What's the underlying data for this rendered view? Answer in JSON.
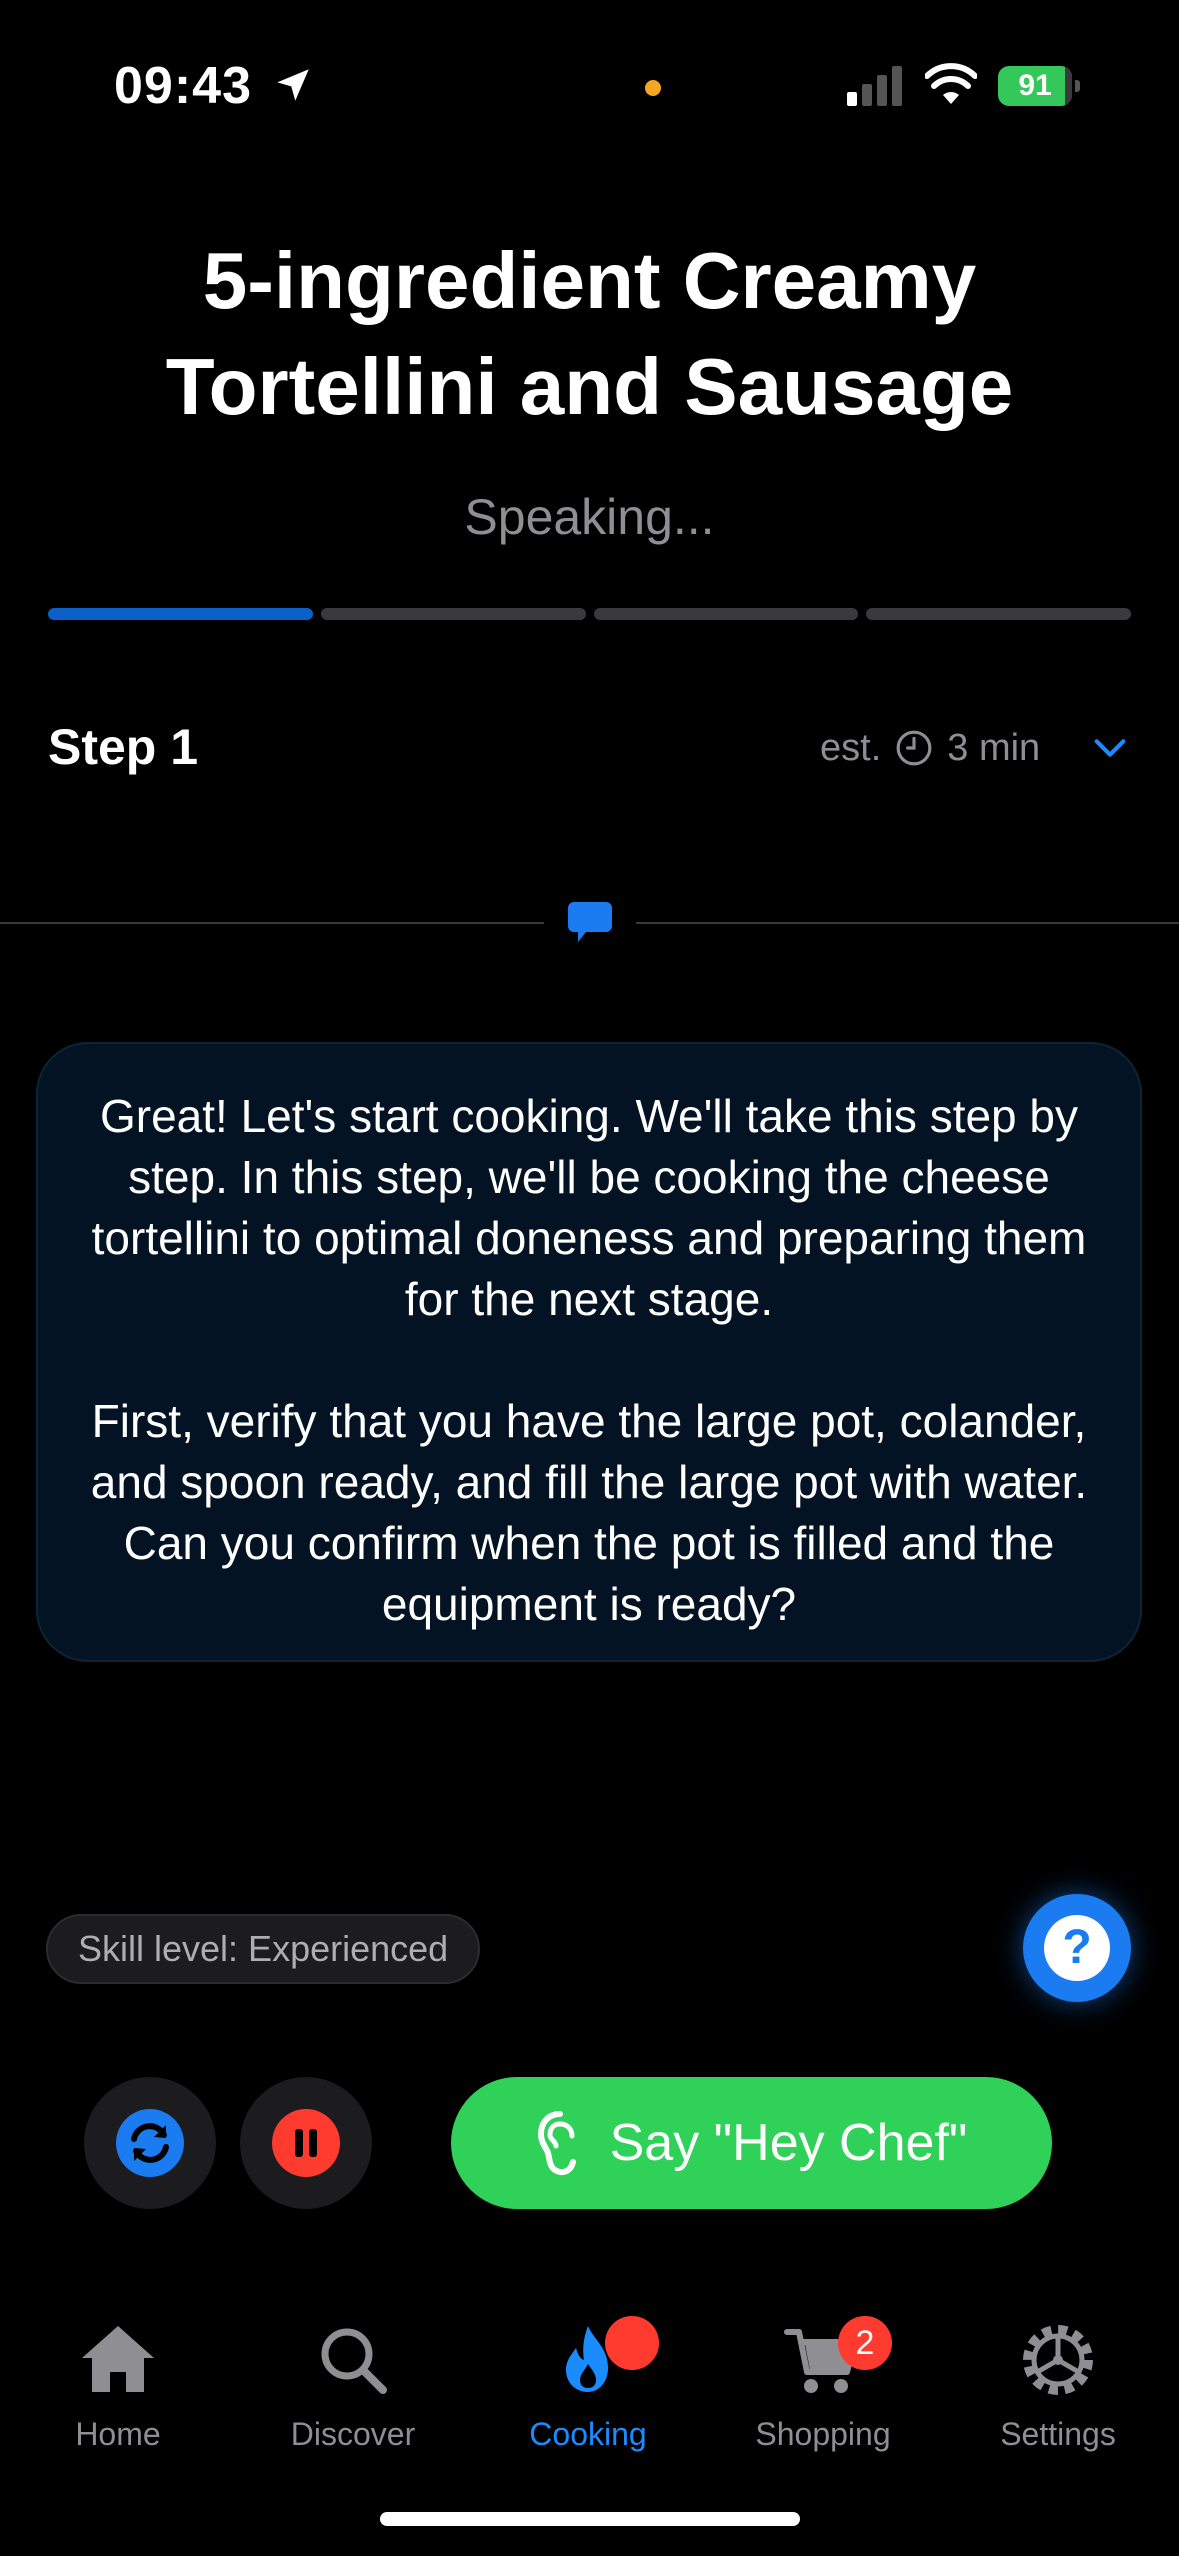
{
  "status_bar": {
    "time": "09:43",
    "battery_level": "91"
  },
  "recipe": {
    "title": "5-ingredient Creamy Tortellini and Sausage",
    "status": "Speaking...",
    "progress_steps": 4,
    "current_step_index": 1
  },
  "step": {
    "title": "Step 1",
    "est_prefix": "est.",
    "est_time": "3 min"
  },
  "message": {
    "paragraphs": [
      "Great! Let's start cooking. We'll take this step by step. In this step, we'll be cooking the cheese tortellini to optimal doneness and preparing them for the next stage.",
      "First, verify that you have the large pot, colander, and spoon ready, and fill the large pot with water. Can you confirm when the pot is filled and the equipment is ready?"
    ]
  },
  "skill_chip": "Skill level: Experienced",
  "help_label": "?",
  "controls": {
    "say_label": "Say \"Hey Chef\""
  },
  "tabs": [
    {
      "label": "Home",
      "icon": "home-icon"
    },
    {
      "label": "Discover",
      "icon": "search-icon"
    },
    {
      "label": "Cooking",
      "icon": "flame-icon",
      "active": true
    },
    {
      "label": "Shopping",
      "icon": "cart-icon",
      "badge": "2"
    },
    {
      "label": "Settings",
      "icon": "gear-icon"
    }
  ],
  "colors": {
    "accent_blue": "#1a8cff",
    "progress_blue": "#0a60c8",
    "say_green": "#30d158",
    "badge_red": "#ff3b30",
    "card_bg": "#041324"
  }
}
